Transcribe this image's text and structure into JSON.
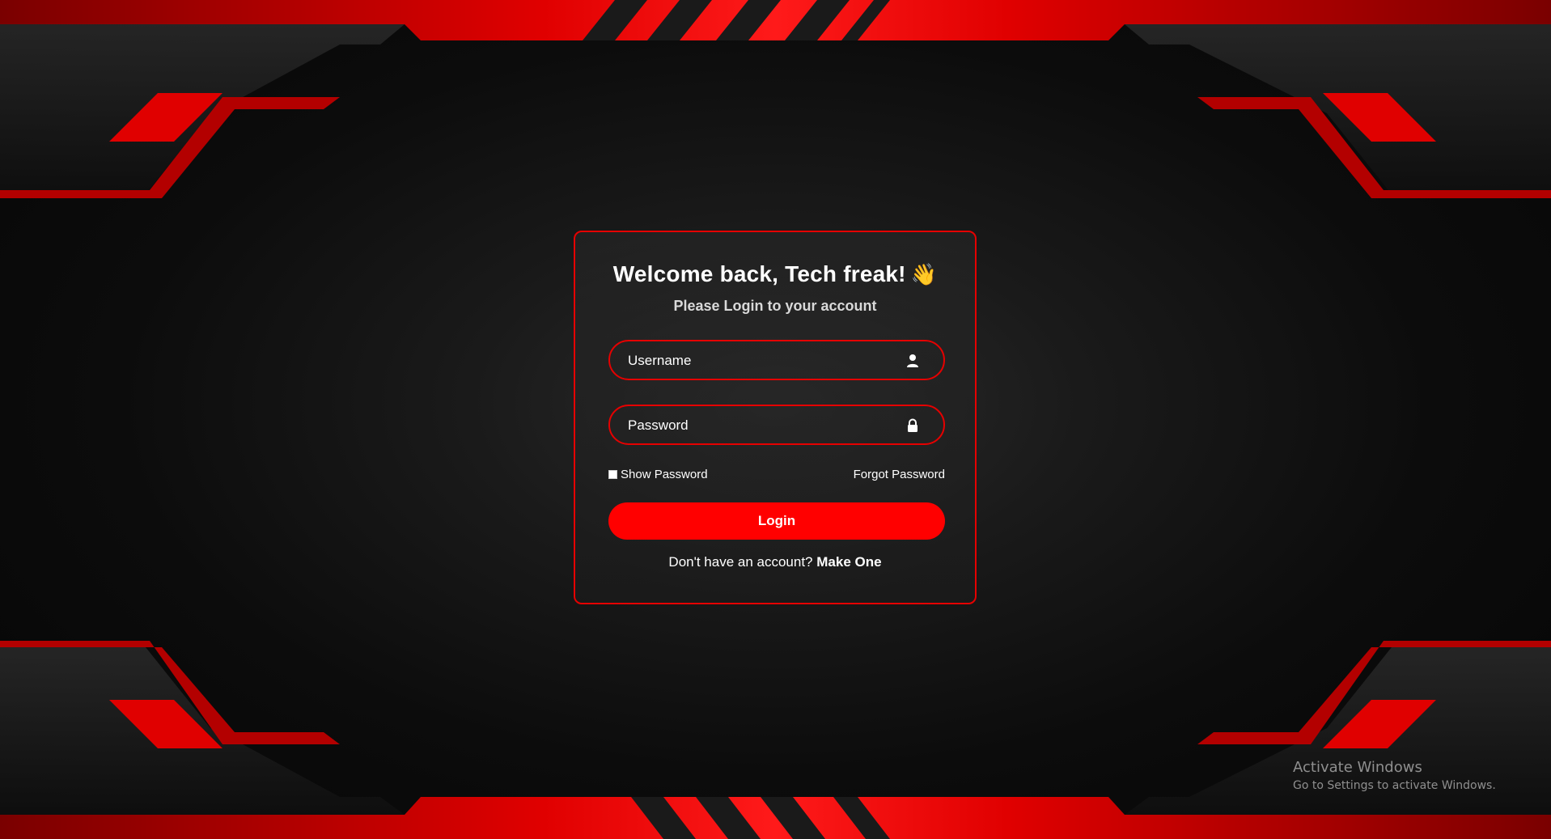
{
  "login_card": {
    "title": "Welcome back, Tech freak!",
    "title_emoji": "👋",
    "subtitle": "Please Login to your account",
    "username": {
      "value": "",
      "placeholder": "Username",
      "icon": "user-icon"
    },
    "password": {
      "value": "",
      "placeholder": "Password",
      "icon": "lock-icon"
    },
    "show_password_label": "Show Password",
    "show_password_checked": false,
    "forgot_password_label": "Forgot Password",
    "login_button_label": "Login",
    "signup_prompt": "Don't have an account?",
    "signup_link_label": "Make One"
  },
  "watermark": {
    "line1": "Activate Windows",
    "line2": "Go to Settings to activate Windows."
  },
  "colors": {
    "accent": "#ff0000",
    "border": "#e60000",
    "background": "#0b0b0b",
    "text": "#ffffff"
  }
}
